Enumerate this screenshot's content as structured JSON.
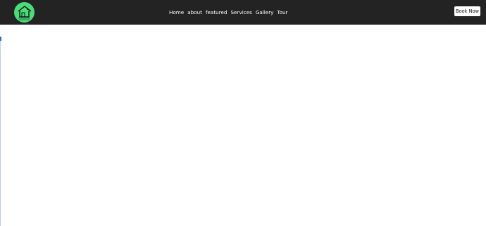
{
  "header": {
    "logo_icon": "house-logo-icon",
    "logo_text": "",
    "nav": [
      {
        "label": "Home"
      },
      {
        "label": "about"
      },
      {
        "label": "featured"
      },
      {
        "label": "Services"
      },
      {
        "label": "Gallery"
      },
      {
        "label": "Tour"
      }
    ],
    "book_button_label": "Book Now"
  },
  "colors": {
    "navbar_bg": "#232323",
    "logo_bg": "#4bdc7a",
    "button_bg": "#ffffff",
    "page_bg": "#ffffff"
  }
}
